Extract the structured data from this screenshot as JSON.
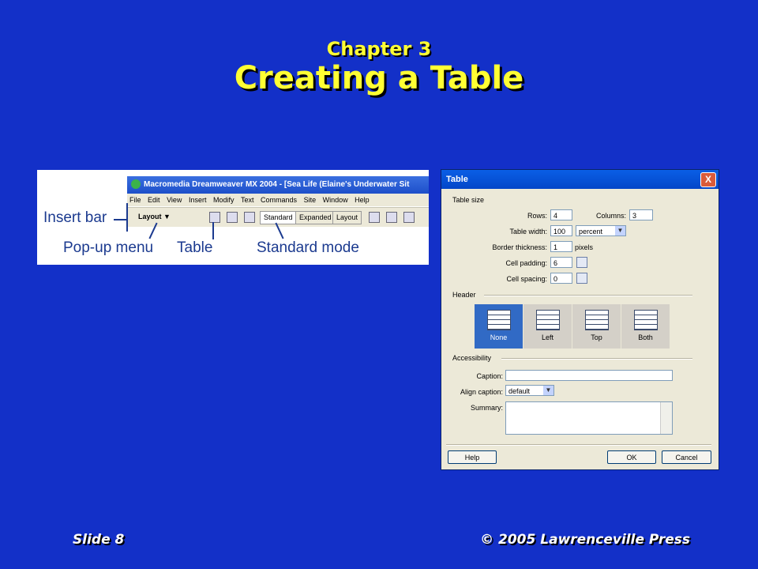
{
  "slide": {
    "chapter": "Chapter 3",
    "heading": "Creating a Table",
    "footer_left": "Slide 8",
    "footer_right": "© 2005 Lawrenceville Press"
  },
  "insert_bar_shot": {
    "window_title": "Macromedia Dreamweaver MX 2004 - [Sea Life (Elaine's Underwater Sit",
    "menu": [
      "File",
      "Edit",
      "View",
      "Insert",
      "Modify",
      "Text",
      "Commands",
      "Site",
      "Window",
      "Help"
    ],
    "layout_dropdown": "Layout",
    "modes": [
      "Standard",
      "Expanded",
      "Layout"
    ],
    "callouts": {
      "insert_bar": "Insert bar",
      "popup_menu": "Pop-up menu",
      "table": "Table",
      "standard_mode": "Standard mode"
    }
  },
  "dialog": {
    "title": "Table",
    "close": "X",
    "sections": {
      "size": "Table size",
      "header": "Header",
      "accessibility": "Accessibility"
    },
    "labels": {
      "rows": "Rows:",
      "columns": "Columns:",
      "width": "Table width:",
      "border": "Border thickness:",
      "padding": "Cell padding:",
      "spacing": "Cell spacing:",
      "pixels": "pixels",
      "caption": "Caption:",
      "align_caption": "Align caption:",
      "summary": "Summary:"
    },
    "values": {
      "rows": "4",
      "columns": "3",
      "width": "100",
      "width_unit": "percent",
      "border": "1",
      "padding": "6",
      "spacing": "0",
      "caption": "",
      "align_caption": "default"
    },
    "header_options": [
      "None",
      "Left",
      "Top",
      "Both"
    ],
    "header_selected": "None",
    "buttons": {
      "help": "Help",
      "ok": "OK",
      "cancel": "Cancel"
    }
  }
}
